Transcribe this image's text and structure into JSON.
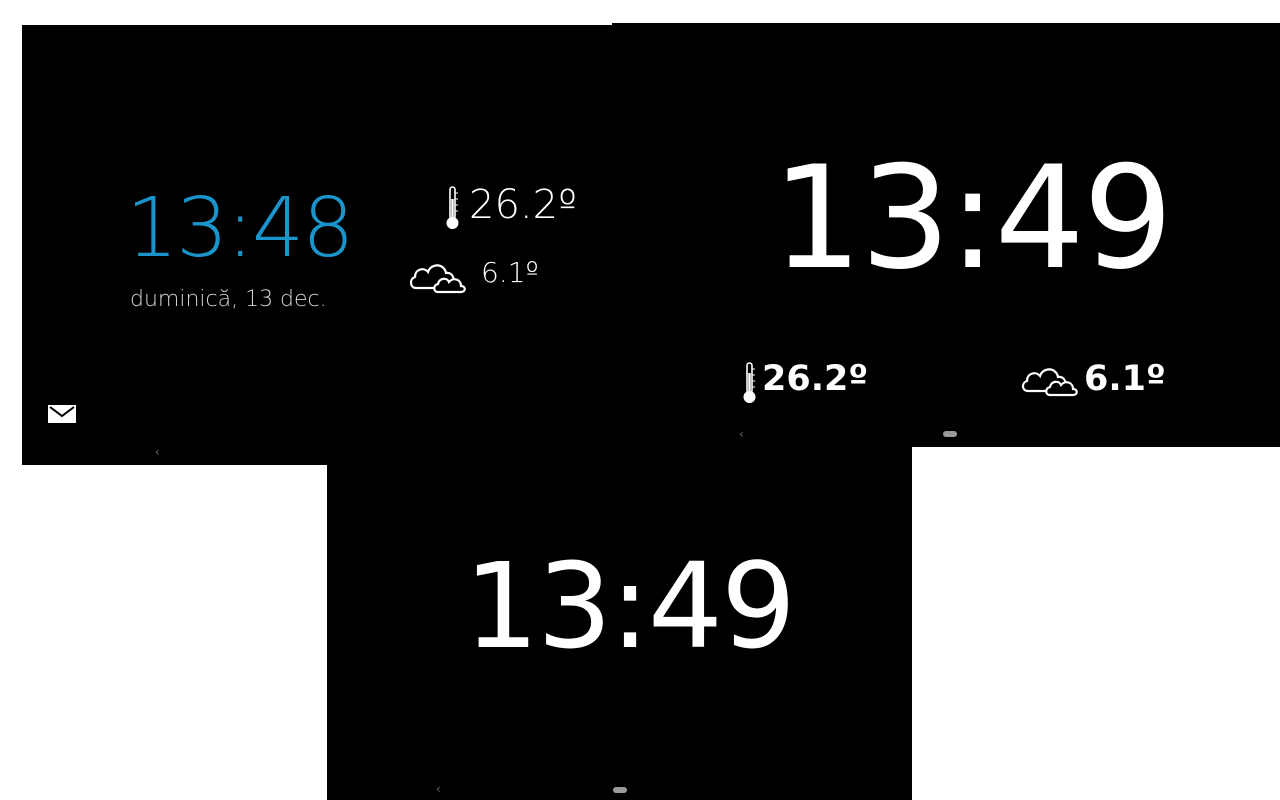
{
  "colors": {
    "background": "#000000",
    "accent_clock": "#1a95cc",
    "text": "#ffffff",
    "date_text": "#d6d6d6",
    "page": "#ffffff"
  },
  "screens": [
    {
      "clock": "13:48",
      "date": "duminică, 13 dec.",
      "indoor_temp": "26.2º",
      "outdoor_temp": "6.1º",
      "icons": [
        "thermometer-icon",
        "cloud-icon",
        "mail-icon"
      ],
      "nav": {
        "back": "‹"
      }
    },
    {
      "clock": "13:49",
      "indoor_temp": "26.2º",
      "outdoor_temp": "6.1º",
      "icons": [
        "thermometer-icon",
        "cloud-icon"
      ],
      "nav": {
        "back": "‹"
      }
    },
    {
      "clock": "13:49",
      "nav": {
        "back": "‹"
      }
    }
  ]
}
